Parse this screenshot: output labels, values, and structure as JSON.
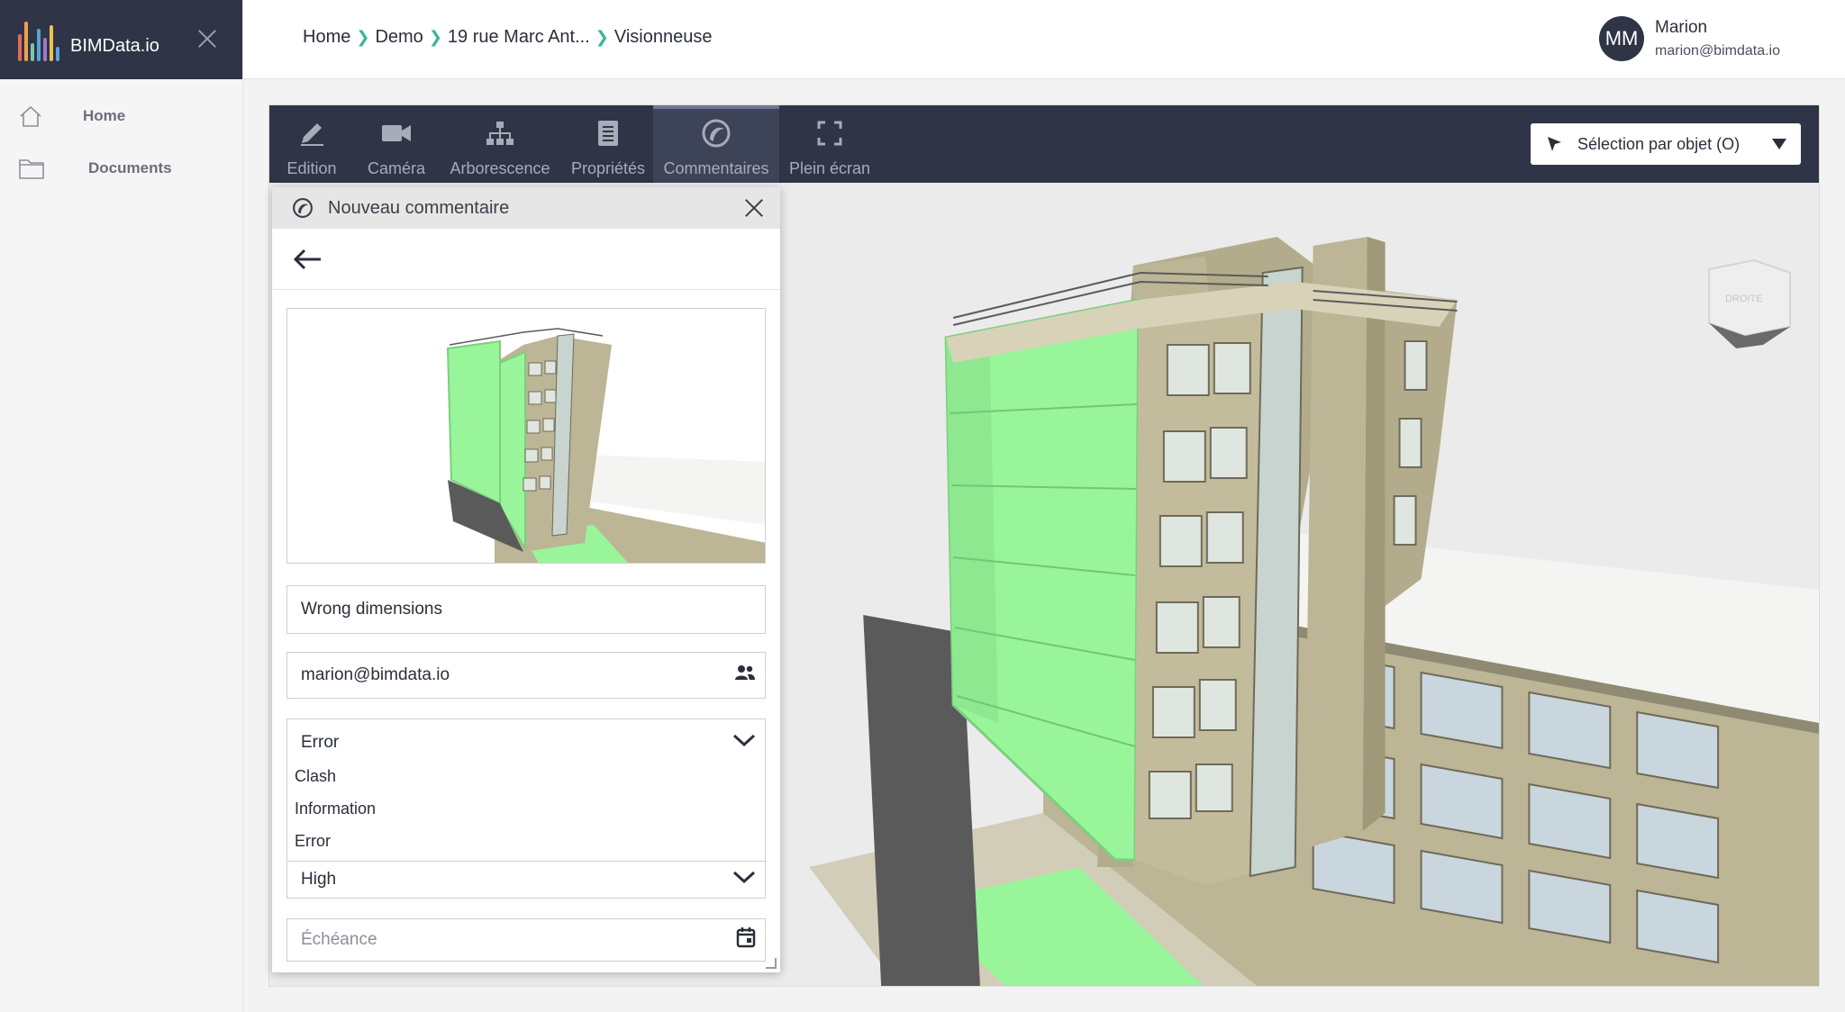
{
  "brand": {
    "name": "BIMData.io",
    "bar_colors": [
      "#e06a5b",
      "#f0a04b",
      "#7bc6a4",
      "#5aa3d9",
      "#a178c7",
      "#f0c24b",
      "#5aa3d9"
    ]
  },
  "sidebar": {
    "items": [
      {
        "label": "Home",
        "icon": "home-icon"
      },
      {
        "label": "Documents",
        "icon": "folder-icon"
      }
    ]
  },
  "breadcrumb": [
    "Home",
    "Demo",
    "19 rue Marc Ant...",
    "Visionneuse"
  ],
  "user": {
    "initials": "MM",
    "name": "Marion",
    "email": "marion@bimdata.io"
  },
  "toolbar": {
    "tools": [
      {
        "label": "Edition",
        "icon": "pencil-icon"
      },
      {
        "label": "Caméra",
        "icon": "camera-icon"
      },
      {
        "label": "Arborescence",
        "icon": "tree-icon"
      },
      {
        "label": "Propriétés",
        "icon": "properties-icon"
      },
      {
        "label": "Commentaires",
        "icon": "comments-icon",
        "active": true
      },
      {
        "label": "Plein écran",
        "icon": "fullscreen-icon"
      }
    ],
    "selection_mode": "Sélection par objet (O)"
  },
  "viewcube": {
    "face_label": "DROITE"
  },
  "comment_panel": {
    "title": "Nouveau commentaire",
    "title_value": "Wrong dimensions",
    "assignee": "marion@bimdata.io",
    "type_selected": "Error",
    "type_options": [
      "Clash",
      "Information",
      "Error"
    ],
    "priority_selected": "High",
    "due_date_placeholder": "Échéance"
  },
  "colors": {
    "accent": "#3ab795",
    "toolbar": "#2f3446",
    "highlight": "#98f59a",
    "building": "#bcb596"
  }
}
